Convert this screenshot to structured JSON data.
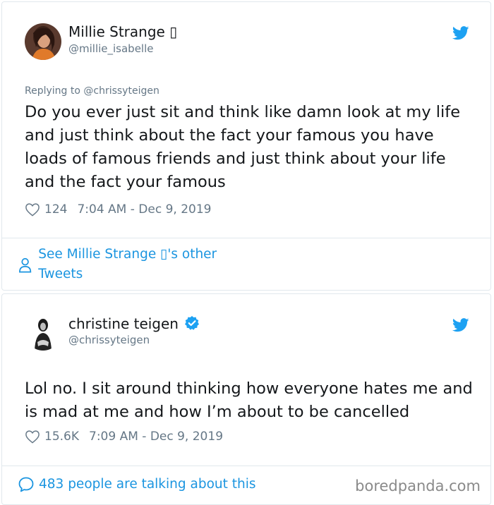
{
  "tweets": [
    {
      "author_name": "Millie Strange",
      "name_suffix": "▯",
      "handle": "@millie_isabelle",
      "replying_to": "Replying to @chrissyteigen",
      "text": "Do you ever just sit and think like damn look at my life and just think about the fact your famous you have loads of famous friends and just think about your life and the fact your famous",
      "likes": "124",
      "timestamp": "7:04 AM - Dec 9, 2019",
      "footer_link": "See Millie Strange ▯'s other Tweets"
    },
    {
      "author_name": "christine teigen",
      "verified": true,
      "handle": "@chrissyteigen",
      "text": "Lol no. I sit around thinking how everyone hates me and is mad at me and how I’m about to be cancelled",
      "likes": "15.6K",
      "timestamp": "7:09 AM - Dec 9, 2019",
      "footer_link": "483 people are talking about this"
    }
  ],
  "watermark": "boredpanda.com",
  "colors": {
    "twitter_blue": "#1da1f2",
    "link_blue": "#1b95e0",
    "secondary_text": "#657786",
    "border": "#e1e8ed"
  },
  "icons": [
    "twitter-bird-icon",
    "heart-icon",
    "person-icon",
    "chat-bubble-icon",
    "verified-badge-icon"
  ]
}
